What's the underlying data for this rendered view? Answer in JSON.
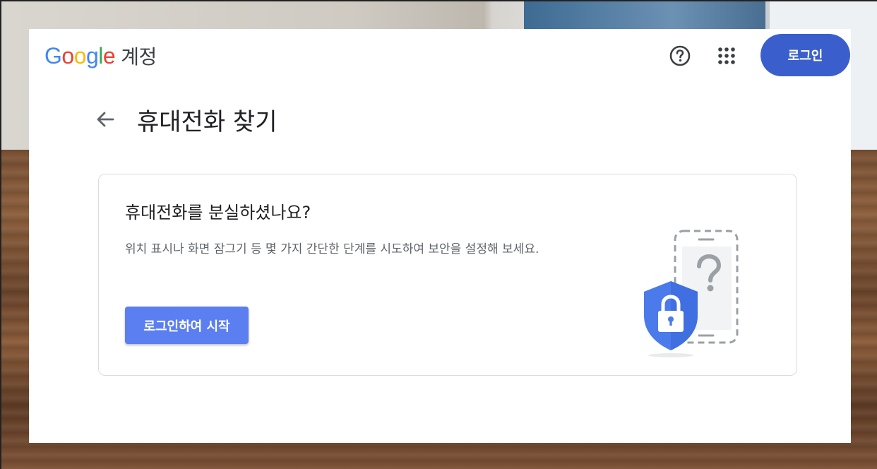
{
  "header": {
    "logo_letters": [
      "G",
      "o",
      "o",
      "g",
      "l",
      "e"
    ],
    "product": "계정",
    "help_icon": "help-circle-icon",
    "apps_icon": "apps-grid-icon",
    "signin_label": "로그인"
  },
  "page": {
    "back_icon": "arrow-back-icon",
    "title": "휴대전화 찾기"
  },
  "card": {
    "title": "휴대전화를 분실하셨나요?",
    "description": "위치 표시나 화면 잠그기 등 몇 가지 간단한 단계를 시도하여 보안을 설정해 보세요.",
    "button_label": "로그인하여 시작",
    "illustration_icons": [
      "phone-shield-lock-icon"
    ]
  },
  "colors": {
    "primary": "#3a5fcd",
    "button": "#5b7ff0",
    "shield": "#4b7bea"
  }
}
